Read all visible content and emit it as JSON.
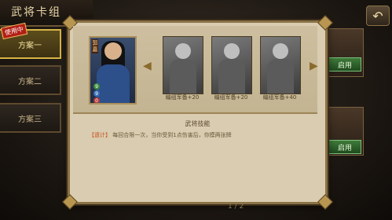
{
  "title": "武将卡组",
  "tabs": [
    {
      "label": "方案一",
      "active": true
    },
    {
      "label": "方案二",
      "active": false
    },
    {
      "label": "方案三",
      "active": false
    }
  ],
  "badge": "使用中",
  "right_buttons": [
    "启用",
    "启用"
  ],
  "back_icon": "back-arrow-icon",
  "modal": {
    "main_card": {
      "name": "郭嘉",
      "stats": [
        9,
        9,
        0
      ]
    },
    "cards": [
      {
        "label": "编组军备+20"
      },
      {
        "label": "编组军备+20"
      },
      {
        "label": "编组军备+40"
      }
    ],
    "skill_title": "武将技能",
    "skill_name": "【遗计】",
    "skill_desc": "每回合限一次，当你受到1点伤害后，你摸两张牌"
  },
  "paging": "1 / 2",
  "colors": {
    "accent": "#d8b547",
    "panel": "#d9ccb0",
    "skill_name": "#c8531f"
  }
}
